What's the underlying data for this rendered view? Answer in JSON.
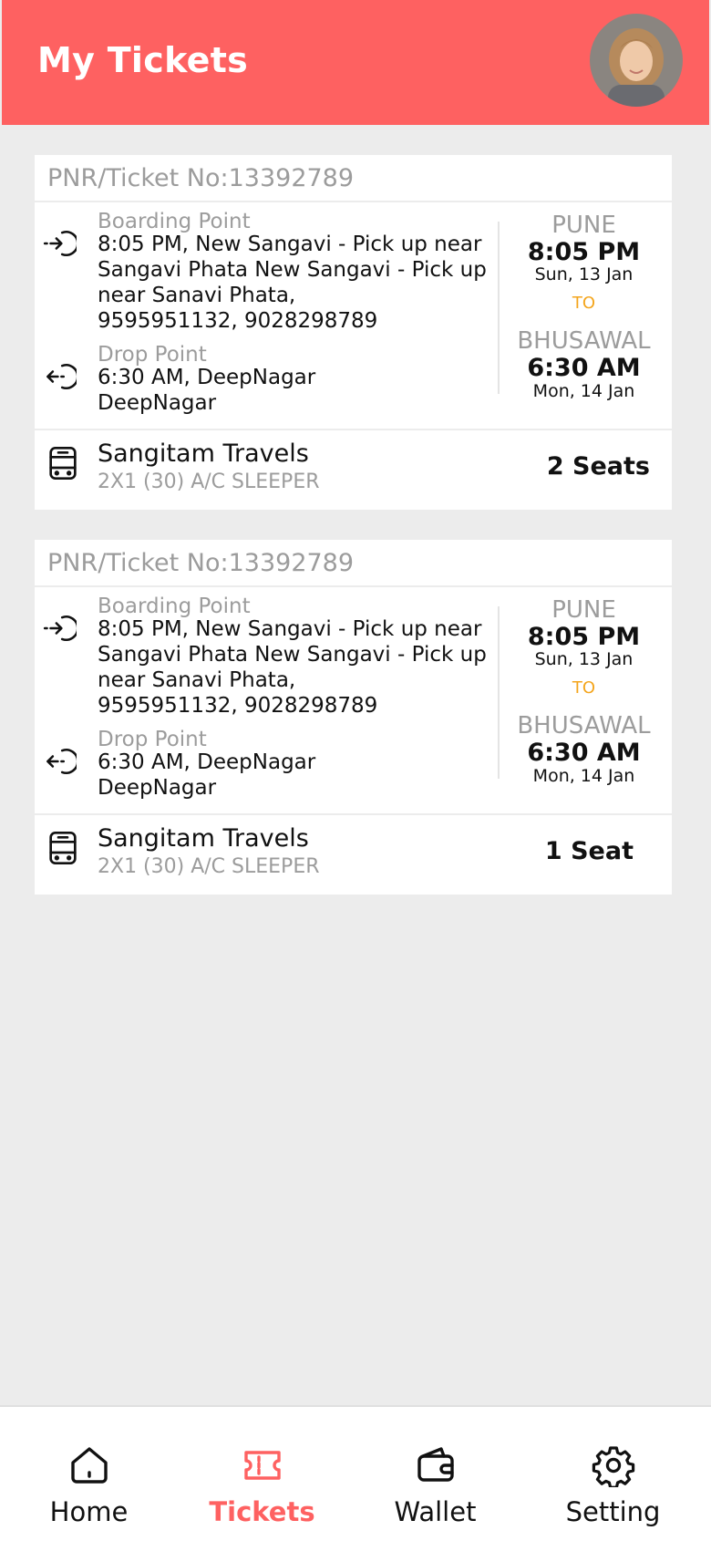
{
  "header": {
    "title": "My Tickets"
  },
  "labels": {
    "boarding": "Boarding Point",
    "drop": "Drop Point",
    "to": "TO"
  },
  "tickets": [
    {
      "pnr": "PNR/Ticket No:13392789",
      "boarding_lines": [
        "8:05 PM, New Sangavi - Pick up near",
        "Sangavi Phata New Sangavi - Pick up",
        "near Sanavi Phata,",
        "9595951132, 9028298789"
      ],
      "drop_lines": [
        "6:30 AM, DeepNagar",
        "DeepNagar"
      ],
      "from_city": "PUNE",
      "from_time": "8:05 PM",
      "from_date": "Sun, 13 Jan",
      "to_city": "BHUSAWAL",
      "to_time": "6:30 AM",
      "to_date": "Mon, 14 Jan",
      "operator": "Sangitam Travels",
      "bus_type": "2X1 (30) A/C SLEEPER",
      "seats": "2 Seats"
    },
    {
      "pnr": "PNR/Ticket No:13392789",
      "boarding_lines": [
        "8:05 PM, New Sangavi - Pick up near",
        "Sangavi Phata New Sangavi - Pick up",
        "near Sanavi Phata,",
        "9595951132, 9028298789"
      ],
      "drop_lines": [
        "6:30 AM, DeepNagar",
        "DeepNagar"
      ],
      "from_city": "PUNE",
      "from_time": "8:05 PM",
      "from_date": "Sun, 13 Jan",
      "to_city": "BHUSAWAL",
      "to_time": "6:30 AM",
      "to_date": "Mon, 14 Jan",
      "operator": "Sangitam Travels",
      "bus_type": "2X1 (30) A/C SLEEPER",
      "seats": "1 Seat"
    }
  ],
  "nav": [
    {
      "label": "Home",
      "icon": "home-icon"
    },
    {
      "label": "Tickets",
      "icon": "ticket-icon",
      "active": true
    },
    {
      "label": "Wallet",
      "icon": "wallet-icon"
    },
    {
      "label": "Setting",
      "icon": "gear-icon"
    }
  ],
  "colors": {
    "accent": "#fe6161",
    "to_label": "#f4a51c",
    "muted": "#9c9c9c",
    "background": "#ececec"
  }
}
